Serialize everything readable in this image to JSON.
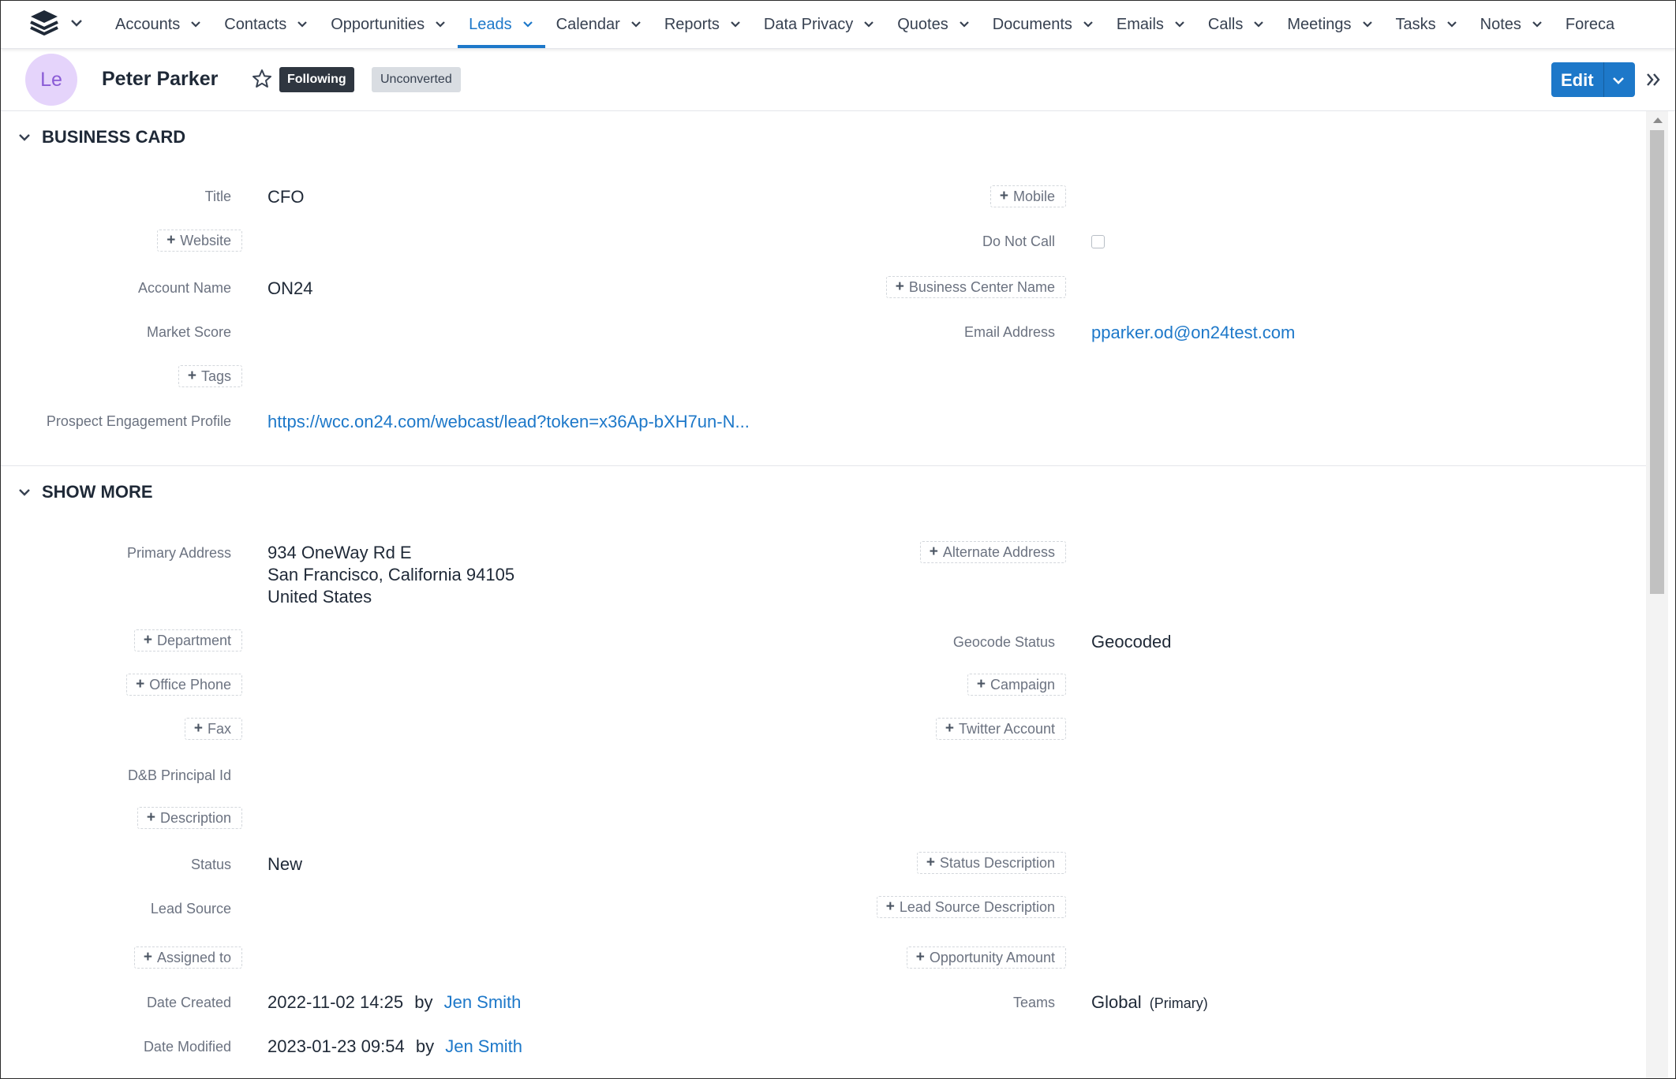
{
  "nav": {
    "items": [
      {
        "label": "Accounts",
        "active": false
      },
      {
        "label": "Contacts",
        "active": false
      },
      {
        "label": "Opportunities",
        "active": false
      },
      {
        "label": "Leads",
        "active": true
      },
      {
        "label": "Calendar",
        "active": false
      },
      {
        "label": "Reports",
        "active": false
      },
      {
        "label": "Data Privacy",
        "active": false
      },
      {
        "label": "Quotes",
        "active": false
      },
      {
        "label": "Documents",
        "active": false
      },
      {
        "label": "Emails",
        "active": false
      },
      {
        "label": "Calls",
        "active": false
      },
      {
        "label": "Meetings",
        "active": false
      },
      {
        "label": "Tasks",
        "active": false
      },
      {
        "label": "Notes",
        "active": false
      },
      {
        "label": "Foreca",
        "active": false
      }
    ]
  },
  "header": {
    "avatar_initials": "Le",
    "name": "Peter Parker",
    "following_label": "Following",
    "status_label": "Unconverted",
    "edit_label": "Edit"
  },
  "business_card": {
    "title": "BUSINESS CARD",
    "title_label": "Title",
    "title_value": "CFO",
    "mobile_add": "Mobile",
    "website_add": "Website",
    "do_not_call_label": "Do Not Call",
    "account_name_label": "Account Name",
    "account_name_value": "ON24",
    "business_center_add": "Business Center Name",
    "market_score_label": "Market Score",
    "email_label": "Email Address",
    "email_value": "pparker.od@on24test.com",
    "tags_add": "Tags",
    "prospect_label": "Prospect Engagement Profile",
    "prospect_value": "https://wcc.on24.com/webcast/lead?token=x36Ap-bXH7un-N..."
  },
  "show_more": {
    "title": "SHOW MORE",
    "primary_address_label": "Primary Address",
    "address_line1": "934 OneWay Rd E",
    "address_line2": "San Francisco, California 94105",
    "address_line3": "United States",
    "alternate_address_add": "Alternate Address",
    "department_add": "Department",
    "geocode_label": "Geocode Status",
    "geocode_value": "Geocoded",
    "office_phone_add": "Office Phone",
    "campaign_add": "Campaign",
    "fax_add": "Fax",
    "twitter_add": "Twitter Account",
    "dnb_label": "D&B Principal Id",
    "description_add": "Description",
    "status_label": "Status",
    "status_value": "New",
    "status_desc_add": "Status Description",
    "lead_source_label": "Lead Source",
    "lead_source_desc_add": "Lead Source Description",
    "assigned_add": "Assigned to",
    "opp_amount_add": "Opportunity Amount",
    "date_created_label": "Date Created",
    "date_created_value": "2022-11-02 14:25",
    "by_text": "by",
    "created_by": "Jen Smith",
    "teams_label": "Teams",
    "teams_value": "Global",
    "teams_primary": "(Primary)",
    "date_modified_label": "Date Modified",
    "date_modified_value": "2023-01-23 09:54",
    "modified_by": "Jen Smith"
  }
}
